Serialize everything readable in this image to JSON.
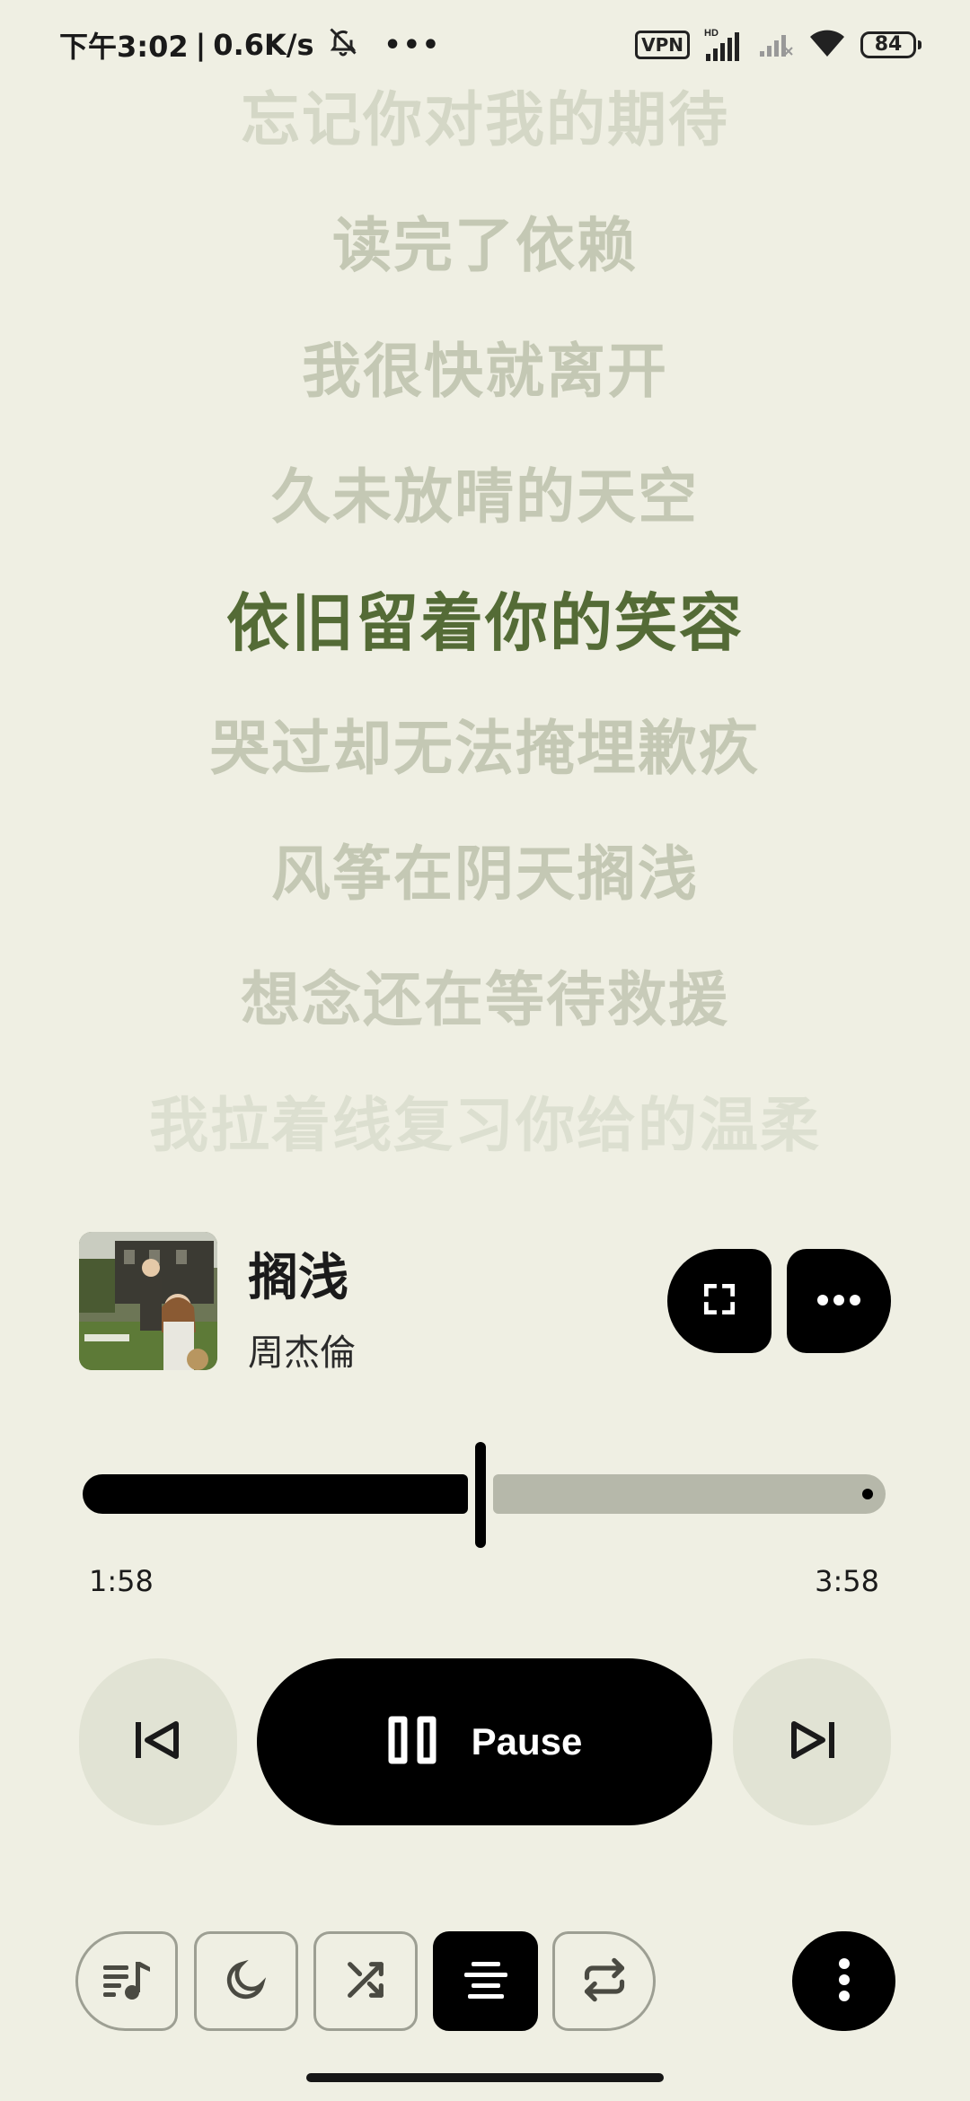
{
  "status_bar": {
    "time": "下午3:02",
    "separator": "|",
    "net_speed": "0.6K/s",
    "vpn": "VPN",
    "hd": "HD",
    "battery": "84"
  },
  "lyrics": {
    "lines": [
      "忘记你对我的期待",
      "读完了依赖",
      "我很快就离开",
      "久未放晴的天空",
      "依旧留着你的笑容",
      "哭过却无法掩埋歉疚",
      "风筝在阴天搁浅",
      "想念还在等待救援",
      "我拉着线复习你给的温柔"
    ],
    "current_index": 4
  },
  "now_playing": {
    "title": "搁浅",
    "artist": "周杰倫"
  },
  "progress": {
    "elapsed": "1:58",
    "total": "3:58",
    "fraction": 0.496
  },
  "controls": {
    "pause_label": "Pause"
  },
  "icons": {
    "status": [
      "mute-bell-icon",
      "more-dots-icon",
      "signal-icon",
      "wifi-icon",
      "battery-icon"
    ],
    "player": [
      "fullscreen-icon",
      "more-horizontal-icon",
      "skip-previous-icon",
      "pause-icon",
      "skip-next-icon"
    ],
    "toolbar": [
      "queue-music-icon",
      "sleep-timer-moon-icon",
      "shuffle-icon",
      "lyrics-align-icon",
      "repeat-icon",
      "more-vertical-icon"
    ]
  },
  "colors": {
    "background": "#efefe3",
    "current_lyric": "#546b36",
    "dim_lyric": "#c4c8b4",
    "accent": "#000000",
    "progress_track": "#b6b8aa"
  }
}
